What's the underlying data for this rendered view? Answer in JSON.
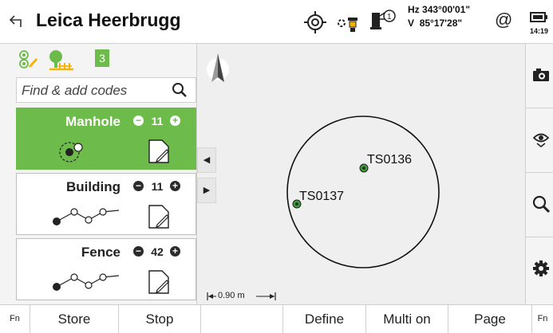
{
  "header": {
    "title": "Leica Heerbrugg",
    "hz_label": "Hz",
    "hz_value": "343°00'01\"",
    "v_label": "V",
    "v_value": "85°17'28\"",
    "at_symbol": "@",
    "time": "14:19",
    "icons": [
      "back-arrow-icon",
      "target-icon",
      "prism-icon",
      "reflectorless-laser-icon",
      "battery-icon"
    ]
  },
  "left_panel": {
    "tab_count": "3",
    "search_placeholder": "Find & add codes",
    "codes": [
      {
        "name": "Manhole",
        "count": "11",
        "type": "point",
        "selected": true
      },
      {
        "name": "Building",
        "count": "11",
        "type": "line",
        "selected": false
      },
      {
        "name": "Fence",
        "count": "42",
        "type": "line",
        "selected": false
      }
    ]
  },
  "map": {
    "points": [
      {
        "label": "TS0136"
      },
      {
        "label": "TS0137"
      }
    ],
    "scale_label": "0.90 m"
  },
  "right_toolbar": {
    "icons": [
      "camera-icon",
      "eye-icon",
      "search-icon",
      "settings-gear-icon"
    ]
  },
  "bottom_bar": {
    "keys": [
      "Fn",
      "Store",
      "Stop",
      "",
      "Define",
      "Multi on",
      "Page",
      "Fn"
    ]
  },
  "colors": {
    "accent_green": "#6dbb4a",
    "point_green": "#3e9b3c"
  }
}
